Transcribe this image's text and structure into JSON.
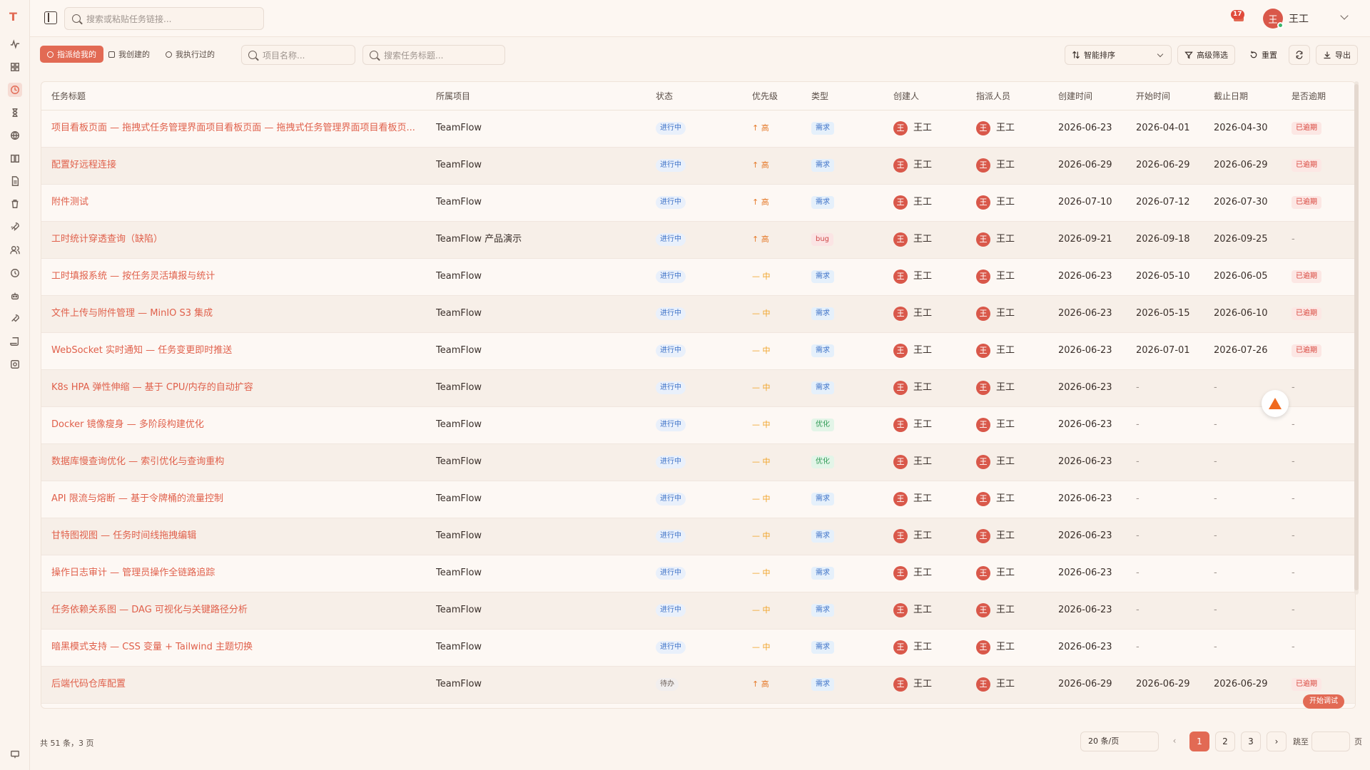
{
  "app": {
    "logo_letter": "T"
  },
  "search": {
    "placeholder": "搜索或粘贴任务链接..."
  },
  "notifications": {
    "count": "17"
  },
  "user": {
    "name": "王工",
    "initial": "王"
  },
  "filters": {
    "tabs": [
      {
        "label": "指派给我的",
        "active": true
      },
      {
        "label": "我创建的",
        "active": false
      },
      {
        "label": "我执行过的",
        "active": false
      }
    ],
    "project_placeholder": "项目名称...",
    "title_placeholder": "搜索任务标题...",
    "sort_label": "智能排序",
    "advanced_filter": "高级筛选",
    "reset": "重置",
    "export": "导出"
  },
  "table": {
    "columns": [
      "任务标题",
      "所属项目",
      "状态",
      "优先级",
      "类型",
      "创建人",
      "指派人员",
      "创建时间",
      "开始时间",
      "截止日期",
      "是否逾期"
    ],
    "rows": [
      {
        "title": "项目看板页面 — 拖拽式任务管理界面项目看板页面 — 拖拽式任务管理界面项目看板页...",
        "project": "TeamFlow",
        "status": "进行中",
        "priority": "高",
        "type": "需求",
        "creator": "王工",
        "assignee": "王工",
        "created": "2026-06-23",
        "start": "2026-04-01",
        "due": "2026-04-30",
        "overdue": "已逾期"
      },
      {
        "title": "配置好远程连接",
        "project": "TeamFlow",
        "status": "进行中",
        "priority": "高",
        "type": "需求",
        "creator": "王工",
        "assignee": "王工",
        "created": "2026-06-29",
        "start": "2026-06-29",
        "due": "2026-06-29",
        "overdue": "已逾期"
      },
      {
        "title": "附件测试",
        "project": "TeamFlow",
        "status": "进行中",
        "priority": "高",
        "type": "需求",
        "creator": "王工",
        "assignee": "王工",
        "created": "2026-07-10",
        "start": "2026-07-12",
        "due": "2026-07-30",
        "overdue": "已逾期"
      },
      {
        "title": "工时统计穿透查询（缺陷）",
        "project": "TeamFlow 产品演示",
        "status": "进行中",
        "priority": "高",
        "type": "bug",
        "creator": "王工",
        "assignee": "王工",
        "created": "2026-09-21",
        "start": "2026-09-18",
        "due": "2026-09-25",
        "overdue": "-"
      },
      {
        "title": "工时填报系统 — 按任务灵活填报与统计",
        "project": "TeamFlow",
        "status": "进行中",
        "priority": "中",
        "type": "需求",
        "creator": "王工",
        "assignee": "王工",
        "created": "2026-06-23",
        "start": "2026-05-10",
        "due": "2026-06-05",
        "overdue": "已逾期"
      },
      {
        "title": "文件上传与附件管理 — MinIO S3 集成",
        "project": "TeamFlow",
        "status": "进行中",
        "priority": "中",
        "type": "需求",
        "creator": "王工",
        "assignee": "王工",
        "created": "2026-06-23",
        "start": "2026-05-15",
        "due": "2026-06-10",
        "overdue": "已逾期"
      },
      {
        "title": "WebSocket 实时通知 — 任务变更即时推送",
        "project": "TeamFlow",
        "status": "进行中",
        "priority": "中",
        "type": "需求",
        "creator": "王工",
        "assignee": "王工",
        "created": "2026-06-23",
        "start": "2026-07-01",
        "due": "2026-07-26",
        "overdue": "已逾期"
      },
      {
        "title": "K8s HPA 弹性伸缩 — 基于 CPU/内存的自动扩容",
        "project": "TeamFlow",
        "status": "进行中",
        "priority": "中",
        "type": "需求",
        "creator": "王工",
        "assignee": "王工",
        "created": "2026-06-23",
        "start": "-",
        "due": "-",
        "overdue": "-"
      },
      {
        "title": "Docker 镜像瘦身 — 多阶段构建优化",
        "project": "TeamFlow",
        "status": "进行中",
        "priority": "中",
        "type": "优化",
        "creator": "王工",
        "assignee": "王工",
        "created": "2026-06-23",
        "start": "-",
        "due": "-",
        "overdue": "-"
      },
      {
        "title": "数据库慢查询优化 — 索引优化与查询重构",
        "project": "TeamFlow",
        "status": "进行中",
        "priority": "中",
        "type": "优化",
        "creator": "王工",
        "assignee": "王工",
        "created": "2026-06-23",
        "start": "-",
        "due": "-",
        "overdue": "-"
      },
      {
        "title": "API 限流与熔断 — 基于令牌桶的流量控制",
        "project": "TeamFlow",
        "status": "进行中",
        "priority": "中",
        "type": "需求",
        "creator": "王工",
        "assignee": "王工",
        "created": "2026-06-23",
        "start": "-",
        "due": "-",
        "overdue": "-"
      },
      {
        "title": "甘特图视图 — 任务时间线拖拽编辑",
        "project": "TeamFlow",
        "status": "进行中",
        "priority": "中",
        "type": "需求",
        "creator": "王工",
        "assignee": "王工",
        "created": "2026-06-23",
        "start": "-",
        "due": "-",
        "overdue": "-"
      },
      {
        "title": "操作日志审计 — 管理员操作全链路追踪",
        "project": "TeamFlow",
        "status": "进行中",
        "priority": "中",
        "type": "需求",
        "creator": "王工",
        "assignee": "王工",
        "created": "2026-06-23",
        "start": "-",
        "due": "-",
        "overdue": "-"
      },
      {
        "title": "任务依赖关系图 — DAG 可视化与关键路径分析",
        "project": "TeamFlow",
        "status": "进行中",
        "priority": "中",
        "type": "需求",
        "creator": "王工",
        "assignee": "王工",
        "created": "2026-06-23",
        "start": "-",
        "due": "-",
        "overdue": "-"
      },
      {
        "title": "暗黑模式支持 — CSS 变量 + Tailwind 主题切换",
        "project": "TeamFlow",
        "status": "进行中",
        "priority": "中",
        "type": "需求",
        "creator": "王工",
        "assignee": "王工",
        "created": "2026-06-23",
        "start": "-",
        "due": "-",
        "overdue": "-"
      },
      {
        "title": "后端代码仓库配置",
        "project": "TeamFlow",
        "status": "待办",
        "priority": "高",
        "type": "需求",
        "creator": "王工",
        "assignee": "王工",
        "created": "2026-06-29",
        "start": "2026-06-29",
        "due": "2026-06-29",
        "overdue": "已逾期"
      }
    ]
  },
  "floating": {
    "debug_label": "开始调试"
  },
  "pagination": {
    "summary": "共 51 条，3 页",
    "page_size": "20 条/页",
    "pages": [
      "1",
      "2",
      "3"
    ],
    "current": "1",
    "jump_prefix": "跳至",
    "jump_suffix": "页"
  },
  "colors": {
    "accent": "#e26a54",
    "overdue": "#d8433a",
    "status_blue": "#3e72c7",
    "optimize_green": "#2f9a55"
  }
}
